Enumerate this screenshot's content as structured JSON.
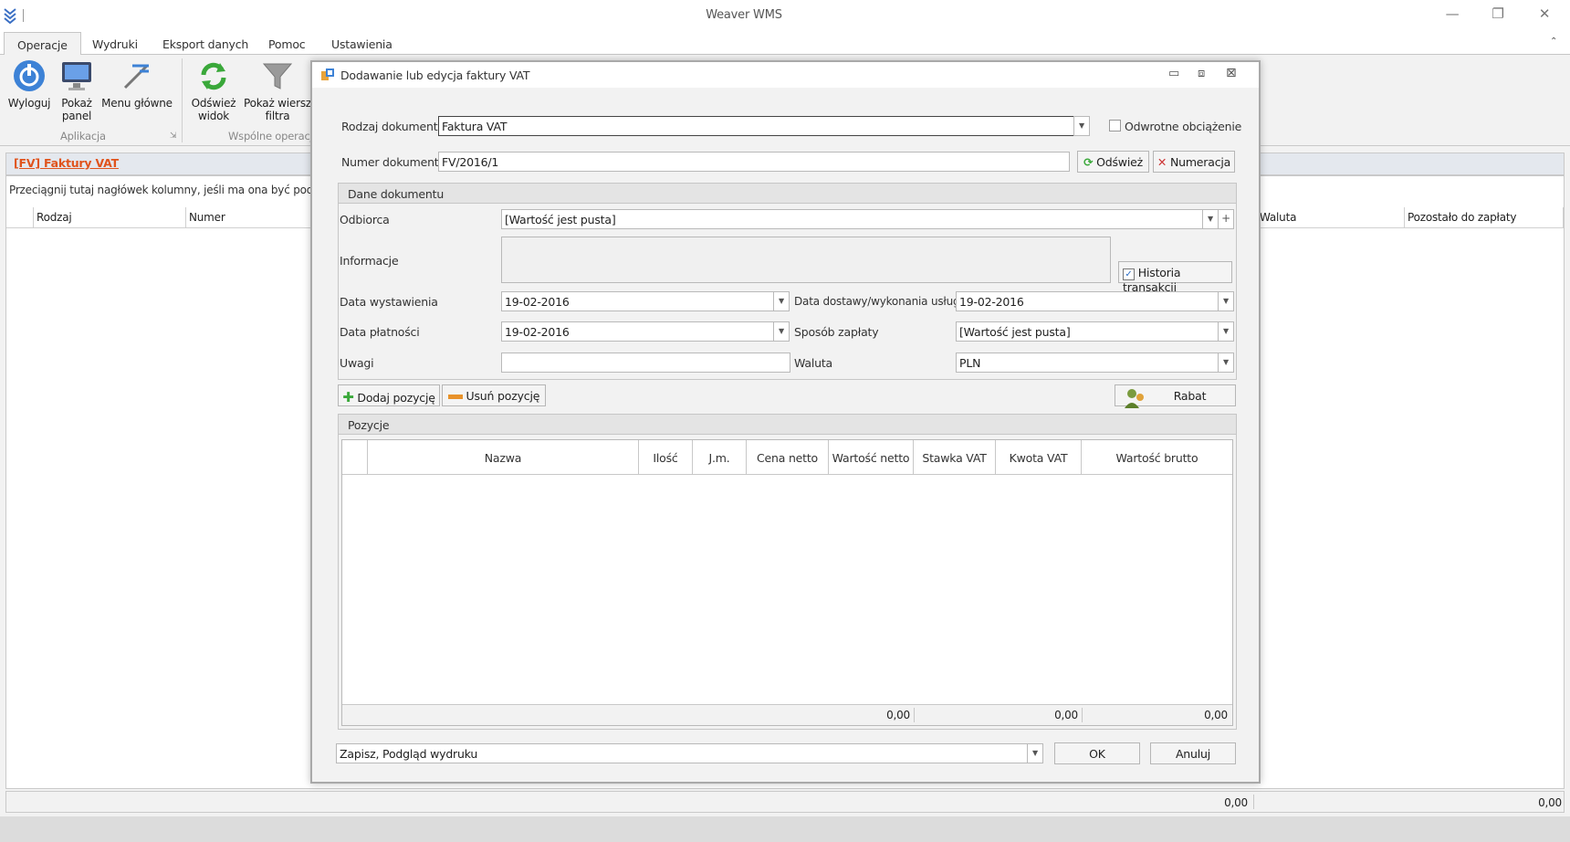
{
  "app": {
    "title": "Weaver WMS"
  },
  "tabs": [
    "Operacje",
    "Wydruki",
    "Eksport danych",
    "Pomoc",
    "Ustawienia"
  ],
  "ribbon": {
    "buttons": {
      "logout": "Wyloguj",
      "show_panel_1": "Pokaż",
      "show_panel_2": "panel",
      "main_menu": "Menu główne",
      "refresh_1": "Odśwież",
      "refresh_2": "widok",
      "filter_1": "Pokaż wiersz",
      "filter_2": "filtra"
    },
    "groups": {
      "app": "Aplikacja",
      "common": "Wspólne operacje"
    }
  },
  "panel": {
    "title": "[FV] Faktury VAT",
    "group_hint": "Przeciągnij tutaj nagłówek kolumny, jeśli ma ona być podstawą grupowania",
    "columns": {
      "c1": "Rodzaj",
      "c2": "Numer",
      "c3": "Waluta",
      "c4": "Pozostało do zapłaty"
    },
    "footer": {
      "sum1": "0,00",
      "sum2": "0,00"
    }
  },
  "dialog": {
    "title": "Dodawanie lub edycja faktury VAT",
    "doc_type_label": "Rodzaj dokumentu",
    "doc_type_value": "Faktura VAT",
    "reverse_charge_label": "Odwrotne obciążenie",
    "reverse_charge_checked": false,
    "doc_number_label": "Numer dokumentu",
    "doc_number_value": "FV/2016/1",
    "refresh_label": "Odśwież",
    "numbering_label": "Numeracja",
    "section_doc": "Dane dokumentu",
    "recipient_label": "Odbiorca",
    "recipient_value": "[Wartość jest pusta]",
    "info_label": "Informacje",
    "history_label": "Historia transakcji",
    "history_checked": true,
    "issue_date_label": "Data wystawienia",
    "issue_date_value": "19-02-2016",
    "delivery_date_label": "Data dostawy/wykonania usługi",
    "delivery_date_value": "19-02-2016",
    "payment_date_label": "Data płatności",
    "payment_date_value": "19-02-2016",
    "payment_method_label": "Sposób zapłaty",
    "payment_method_value": "[Wartość jest pusta]",
    "notes_label": "Uwagi",
    "notes_value": "",
    "currency_label": "Waluta",
    "currency_value": "PLN",
    "add_position_label": "Dodaj pozycję",
    "remove_position_label": "Usuń pozycję",
    "discount_label": "Rabat",
    "section_positions": "Pozycje",
    "positions_columns": [
      "Nazwa",
      "Ilość",
      "J.m.",
      "Cena netto",
      "Wartość netto",
      "Stawka VAT",
      "Kwota VAT",
      "Wartość brutto"
    ],
    "totals": {
      "net": "0,00",
      "vat": "0,00",
      "gross": "0,00"
    },
    "save_option": "Zapisz, Podgląd wydruku",
    "ok_label": "OK",
    "cancel_label": "Anuluj"
  }
}
